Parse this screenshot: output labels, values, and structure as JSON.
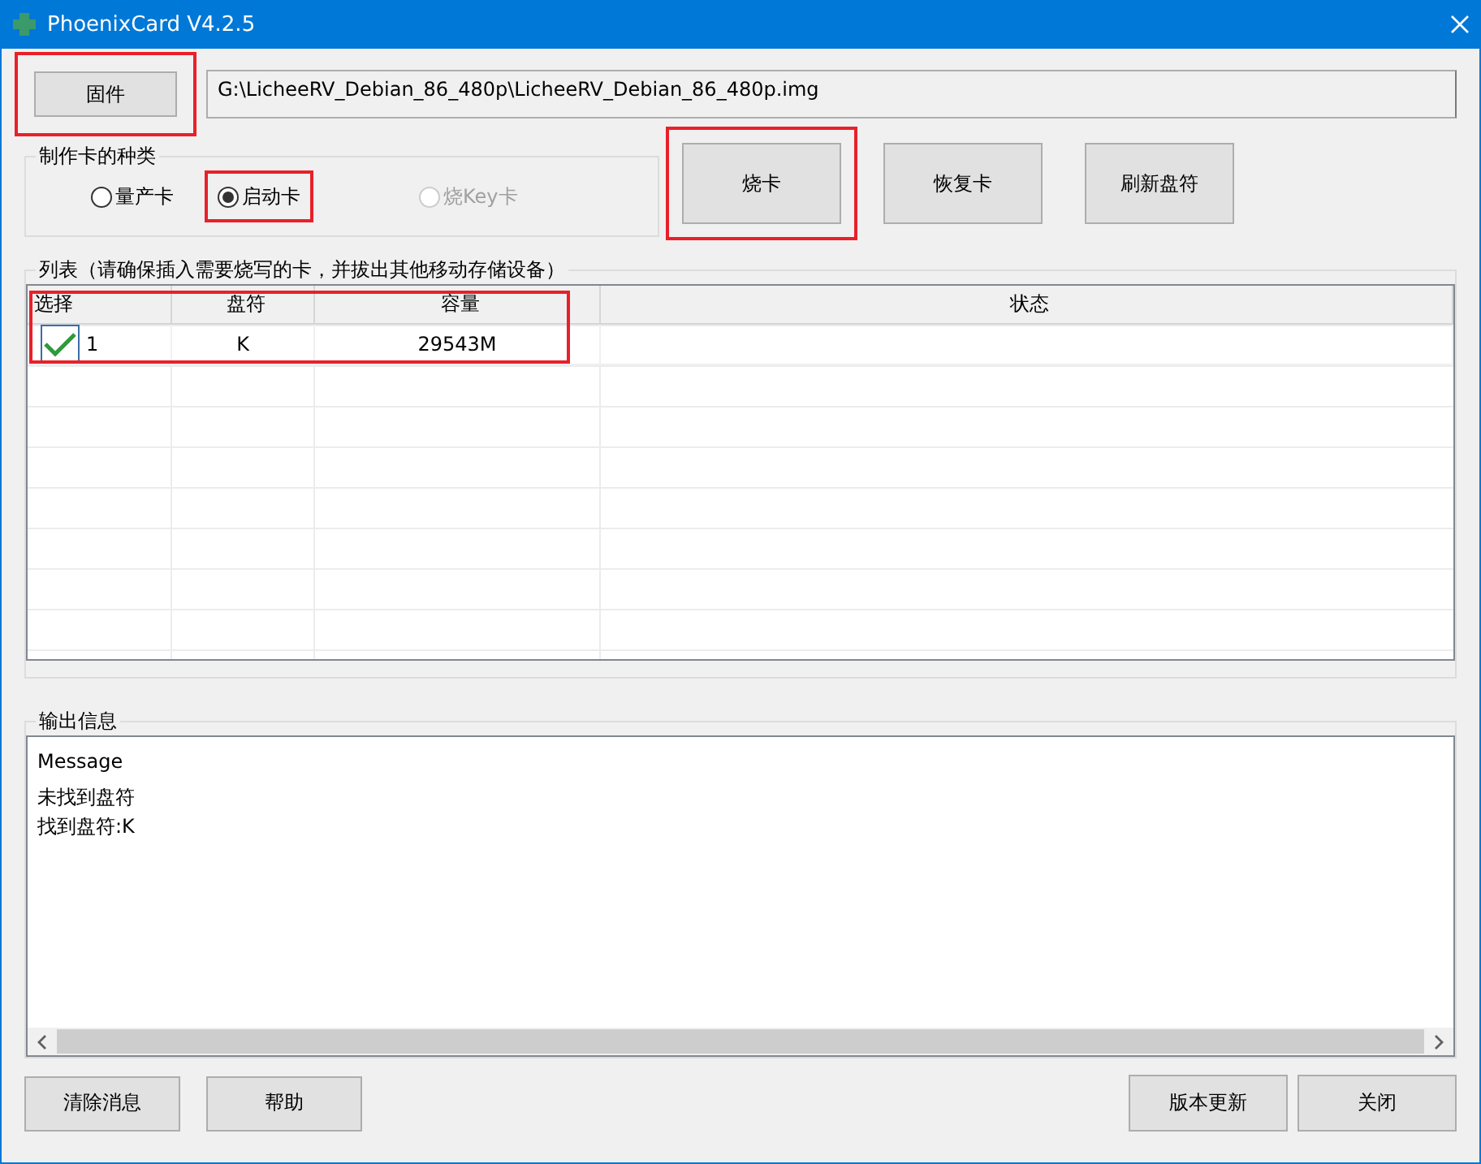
{
  "window": {
    "title": "PhoenixCard V4.2.5"
  },
  "firmware": {
    "button": "固件",
    "highlighted": true,
    "path": "G:\\LicheeRV_Debian_86_480p\\LicheeRV_Debian_86_480p.img"
  },
  "card_type": {
    "label": "制作卡的种类",
    "options": [
      {
        "label": "量产卡",
        "selected": false,
        "disabled": false,
        "highlighted": false
      },
      {
        "label": "启动卡",
        "selected": true,
        "disabled": false,
        "highlighted": true
      },
      {
        "label": "烧Key卡",
        "selected": false,
        "disabled": true,
        "highlighted": false
      }
    ]
  },
  "actions": [
    {
      "label": "烧卡",
      "highlighted": true
    },
    {
      "label": "恢复卡",
      "highlighted": false
    },
    {
      "label": "刷新盘符",
      "highlighted": false
    }
  ],
  "list": {
    "label": "列表（请确保插入需要烧写的卡，并拔出其他移动存储设备）",
    "columns": [
      "选择",
      "盘符",
      "容量",
      "状态"
    ],
    "rows": [
      {
        "checked": true,
        "index": "1",
        "drive": "K",
        "capacity": "29543M",
        "status": "",
        "highlighted": true
      }
    ]
  },
  "output": {
    "label": "输出信息",
    "lines": [
      "Message",
      "未找到盘符",
      "找到盘符:K"
    ]
  },
  "bottom_left": [
    "清除消息",
    "帮助"
  ],
  "bottom_right": [
    "版本更新",
    "关闭"
  ]
}
